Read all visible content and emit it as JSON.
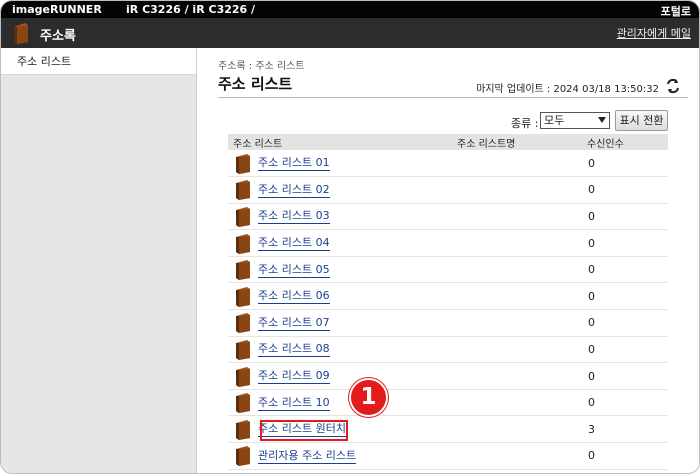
{
  "topbar": {
    "brand": "imageRUNNER",
    "model": "iR C3226 / iR C3226 /",
    "portal": "포털로"
  },
  "titlebar": {
    "title": "주소록",
    "admin_mail": "관리자에게 메일"
  },
  "sidebar": {
    "items": [
      {
        "label": "주소 리스트"
      }
    ]
  },
  "main": {
    "breadcrumb": "주소록 : 주소 리스트",
    "title": "주소 리스트",
    "last_update": "마지막 업데이트 : 2024 03/18 13:50:32",
    "filter": {
      "label": "종류 :",
      "selected": "모두",
      "button": "표시 전환"
    },
    "table": {
      "headers": [
        "주소 리스트",
        "주소 리스트명",
        "수신인수"
      ],
      "rows": [
        {
          "name": "주소 리스트 01",
          "list_name": "",
          "count": "0"
        },
        {
          "name": "주소 리스트 02",
          "list_name": "",
          "count": "0"
        },
        {
          "name": "주소 리스트 03",
          "list_name": "",
          "count": "0"
        },
        {
          "name": "주소 리스트 04",
          "list_name": "",
          "count": "0"
        },
        {
          "name": "주소 리스트 05",
          "list_name": "",
          "count": "0"
        },
        {
          "name": "주소 리스트 06",
          "list_name": "",
          "count": "0"
        },
        {
          "name": "주소 리스트 07",
          "list_name": "",
          "count": "0"
        },
        {
          "name": "주소 리스트 08",
          "list_name": "",
          "count": "0"
        },
        {
          "name": "주소 리스트 09",
          "list_name": "",
          "count": "0"
        },
        {
          "name": "주소 리스트 10",
          "list_name": "",
          "count": "0"
        },
        {
          "name": "주소 리스트 원터치",
          "list_name": "",
          "count": "3"
        },
        {
          "name": "관리자용 주소 리스트",
          "list_name": "",
          "count": "0"
        }
      ]
    }
  },
  "annotation": {
    "marker_number": "1"
  },
  "colors": {
    "topbar": "#050505",
    "titlebar": "#2c2c2c",
    "link": "#1b3f8f",
    "highlight": "#e21b1b",
    "book": "#a0522d"
  },
  "icons": {
    "app": "address-book-icon",
    "row": "address-book-icon",
    "refresh": "refresh-icon",
    "select": "chevron-down-icon"
  }
}
